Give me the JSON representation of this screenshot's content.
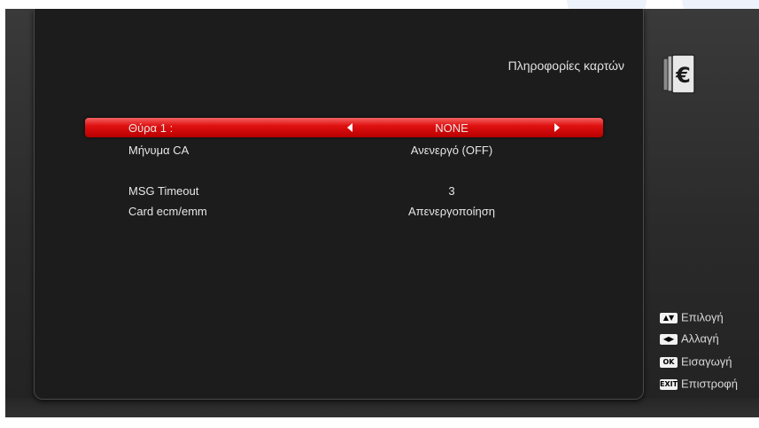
{
  "page": {
    "title": "Πληροφορίες καρτών"
  },
  "icon": {
    "name": "euro-card-icon",
    "glyph": "€"
  },
  "menu": {
    "items": [
      {
        "label": "Θύρα 1 :",
        "value": "NONE",
        "selected": true
      },
      {
        "label": "Μήνυμα CA",
        "value": "Ανενεργό (OFF)"
      },
      {
        "label": "MSG Timeout",
        "value": "3"
      },
      {
        "label": "Card ecm/emm",
        "value": "Απενεργοποίηση"
      }
    ]
  },
  "help": [
    {
      "key": "▲▼",
      "icon": "up-down-key-icon",
      "text": "Επιλογή"
    },
    {
      "key": "◀▶",
      "icon": "left-right-key-icon",
      "text": "Αλλαγή"
    },
    {
      "key": "OK",
      "icon": "ok-key-icon",
      "text": "Εισαγωγή"
    },
    {
      "key": "EXIT",
      "icon": "exit-key-icon",
      "text": "Επιστροφή"
    }
  ],
  "colors": {
    "selected_row": "#e01111",
    "panel": "#1c1c1c",
    "background": "#2e2e2e"
  }
}
